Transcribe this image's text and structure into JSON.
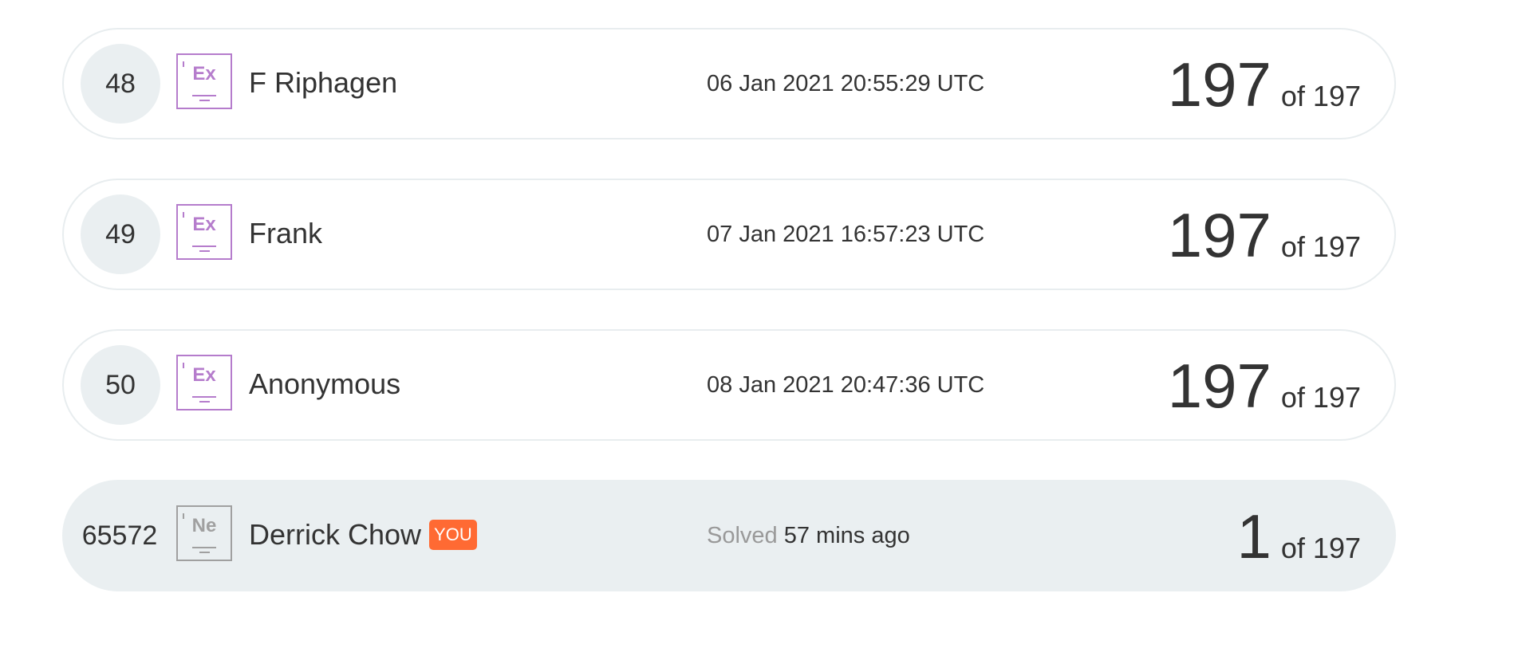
{
  "leaderboard": [
    {
      "rank": "48",
      "level": "Ex",
      "name": "F Riphagen",
      "date": "06 Jan 2021 20:55:29 UTC",
      "score": "197",
      "total": "of 197"
    },
    {
      "rank": "49",
      "level": "Ex",
      "name": "Frank",
      "date": "07 Jan 2021 16:57:23 UTC",
      "score": "197",
      "total": "of 197"
    },
    {
      "rank": "50",
      "level": "Ex",
      "name": "Anonymous",
      "date": "08 Jan 2021 20:47:36 UTC",
      "score": "197",
      "total": "of 197"
    }
  ],
  "me": {
    "rank": "65572",
    "level": "Ne",
    "name": "Derrick Chow",
    "badge": "YOU",
    "solved_label": "Solved",
    "solved_time": "57 mins ago",
    "score": "1",
    "total": "of 197"
  },
  "colors": {
    "expert": "#b57ccc",
    "novice": "#a0a0a0",
    "you_badge": "#ff6a33"
  }
}
